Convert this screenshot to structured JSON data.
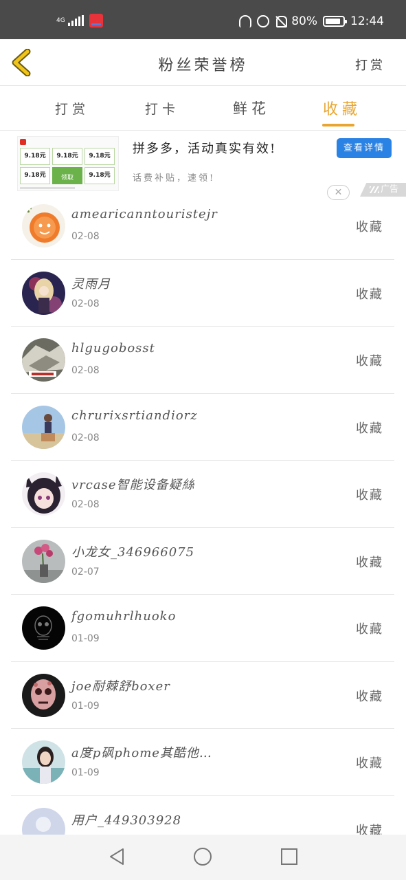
{
  "status_bar": {
    "network": "4G",
    "battery": "80%",
    "time": "12:44"
  },
  "header": {
    "title": "粉丝荣誉榜",
    "right_action": "打赏"
  },
  "tabs": [
    {
      "label": "打赏",
      "active": false
    },
    {
      "label": "打卡",
      "active": false
    },
    {
      "label": "鲜花",
      "active": false
    },
    {
      "label": "收藏",
      "active": true
    }
  ],
  "accent_color": "#e8a631",
  "ad": {
    "title": "拼多多，活动真实有效!",
    "subtitle": "话费补贴，速领!",
    "button": "查看详情",
    "tag": "广告",
    "close": "✕",
    "cells": [
      "9.18元",
      "9.18元",
      "9.18元",
      "9.18元",
      "领取",
      "9.18元"
    ]
  },
  "list": [
    {
      "name": "amearicanntouristejr",
      "date": "02-08",
      "action": "收藏"
    },
    {
      "name": "灵雨月",
      "date": "02-08",
      "action": "收藏"
    },
    {
      "name": "hlgugobosst",
      "date": "02-08",
      "action": "收藏"
    },
    {
      "name": "chrurixsrtiandiorz",
      "date": "02-08",
      "action": "收藏"
    },
    {
      "name": "vrcase智能设备疑絲",
      "date": "02-08",
      "action": "收藏"
    },
    {
      "name": "小龙女_346966075",
      "date": "02-07",
      "action": "收藏"
    },
    {
      "name": "fgomuhrlhuoko",
      "date": "01-09",
      "action": "收藏"
    },
    {
      "name": "joe耐棘舒boxer",
      "date": "01-09",
      "action": "收藏"
    },
    {
      "name": "a度p砜phome其酷他…",
      "date": "01-09",
      "action": "收藏"
    },
    {
      "name": "用户_449303928",
      "date": "",
      "action": "收藏"
    }
  ]
}
